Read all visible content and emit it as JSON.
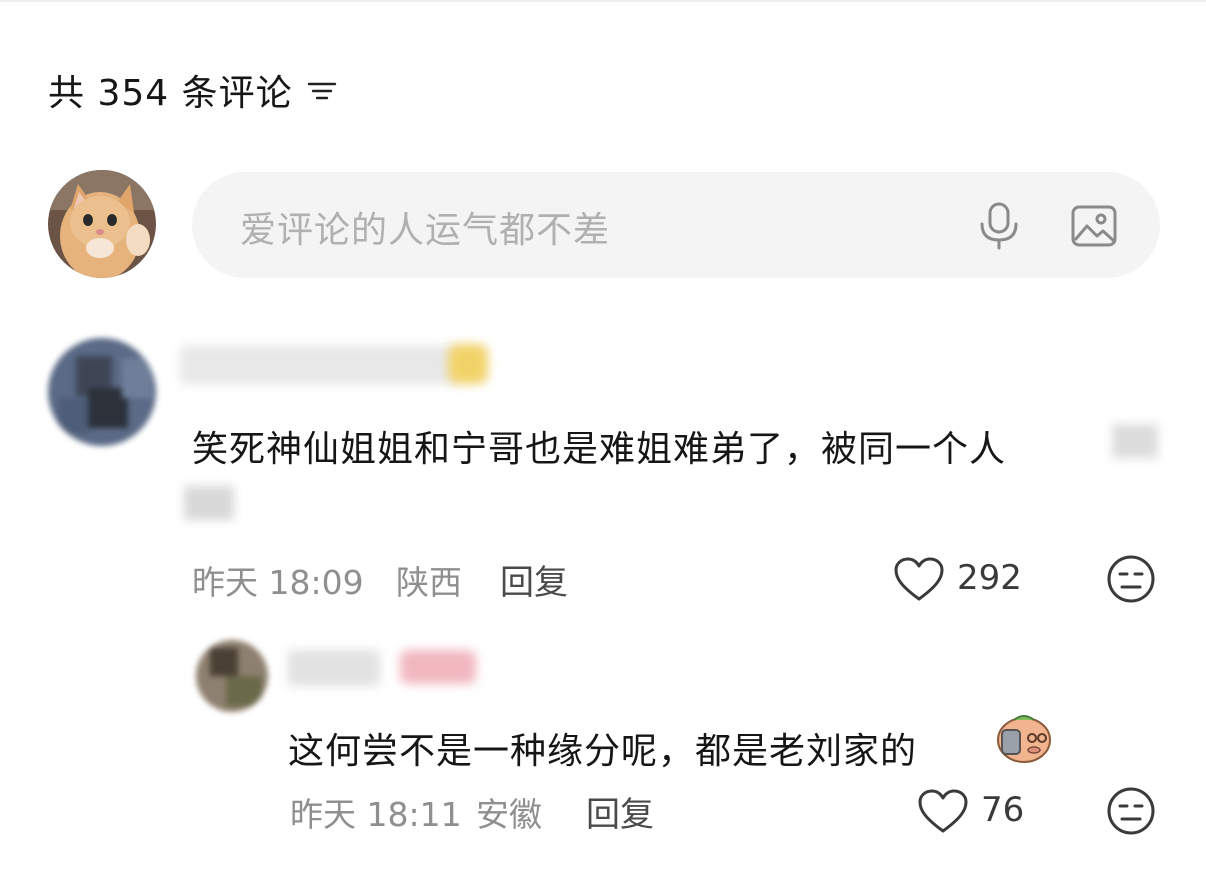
{
  "header": {
    "count_text": "共 354 条评论"
  },
  "input": {
    "placeholder": "爱评论的人运气都不差"
  },
  "comments": [
    {
      "text": "笑死神仙姐姐和宁哥也是难姐难弟了，被同一个人",
      "time": "昨天 18:09",
      "location": "陕西",
      "reply_label": "回复",
      "likes": "292"
    },
    {
      "text": "这何尝不是一种缘分呢，都是老刘家的",
      "time": "昨天 18:11",
      "location": "安徽",
      "reply_label": "回复",
      "likes": "76"
    }
  ],
  "icons": {
    "sort": "filter-lines-icon",
    "mic": "microphone-icon",
    "image": "image-icon",
    "like": "heart-icon",
    "dislike": "dislike-face-icon",
    "emoji": "pig-emoji-icon"
  },
  "colors": {
    "placeholder": "#b0b0b0",
    "meta": "#8f8f8f",
    "input_bg": "#f4f4f4"
  }
}
